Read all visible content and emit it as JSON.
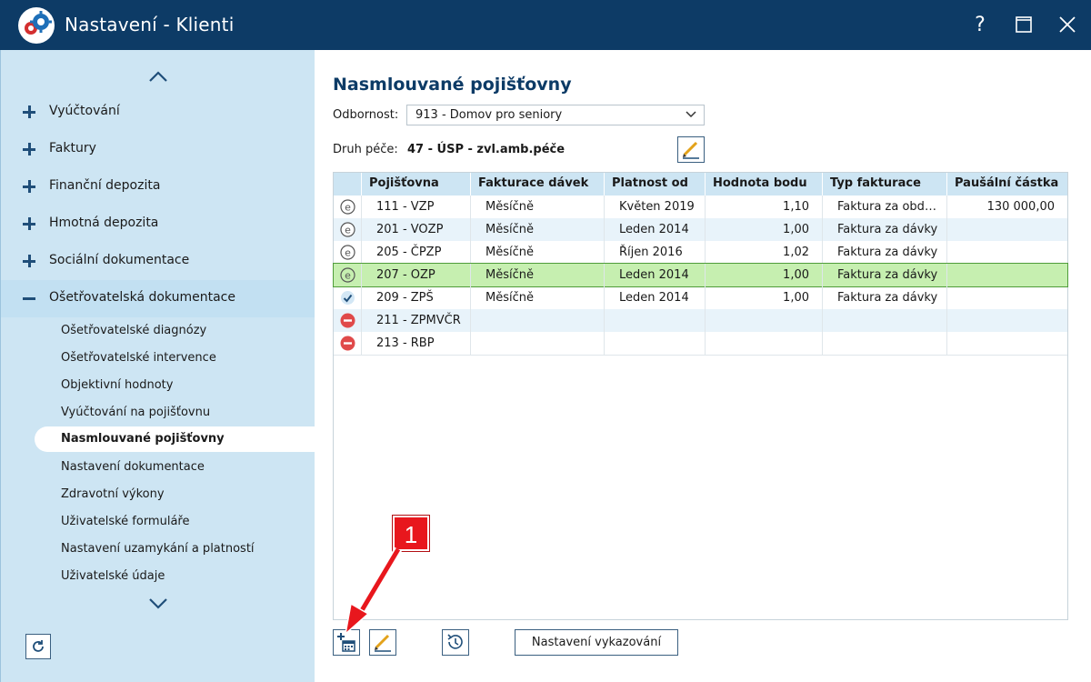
{
  "window": {
    "title": "Nastavení - Klienti",
    "help_label": "?",
    "icons": [
      "app-gears-icon",
      "maximize-icon",
      "close-icon"
    ]
  },
  "sidebar": {
    "groups": [
      {
        "label": "Vyúčtování",
        "icon": "plus-icon"
      },
      {
        "label": "Faktury",
        "icon": "plus-icon"
      },
      {
        "label": "Finanční depozita",
        "icon": "plus-icon"
      },
      {
        "label": "Hmotná depozita",
        "icon": "plus-icon"
      },
      {
        "label": "Sociální dokumentace",
        "icon": "plus-icon"
      },
      {
        "label": "Ošetřovatelská dokumentace",
        "icon": "minus-icon"
      }
    ],
    "subitems": [
      "Ošetřovatelské diagnózy",
      "Ošetřovatelské intervence",
      "Objektivní hodnoty",
      "Vyúčtování na pojišťovnu",
      "Nasmlouvané pojišťovny",
      "Nastavení dokumentace",
      "Zdravotní výkony",
      "Uživatelské formuláře",
      "Nastavení uzamykání a platností",
      "Uživatelské údaje"
    ],
    "active_subitem": "Nasmlouvané pojišťovny"
  },
  "main": {
    "title": "Nasmlouvané pojišťovny",
    "odbornost_label": "Odbornost:",
    "odbornost_value": "913 - Domov pro seniory",
    "druh_label": "Druh péče:",
    "druh_value": "47 - ÚSP - zvl.amb.péče"
  },
  "table": {
    "columns": [
      "Pojišťovna",
      "Fakturace dávek",
      "Platnost od",
      "Hodnota bodu",
      "Typ fakturace",
      "Paušální částka"
    ],
    "rows": [
      {
        "status": "e-icon",
        "pojistovna": "111 - VZP",
        "fakturace": "Měsíčně",
        "platnost": "Květen 2019",
        "hodnota": "1,10",
        "typ": "Faktura za obd…",
        "pausal": "130 000,00"
      },
      {
        "status": "e-icon",
        "pojistovna": "201 - VOZP",
        "fakturace": "Měsíčně",
        "platnost": "Leden 2014",
        "hodnota": "1,00",
        "typ": "Faktura za dávky",
        "pausal": ""
      },
      {
        "status": "e-icon",
        "pojistovna": "205 - ČPZP",
        "fakturace": "Měsíčně",
        "platnost": "Říjen 2016",
        "hodnota": "1,02",
        "typ": "Faktura za dávky",
        "pausal": ""
      },
      {
        "status": "e-icon",
        "pojistovna": "207 - OZP",
        "fakturace": "Měsíčně",
        "platnost": "Leden 2014",
        "hodnota": "1,00",
        "typ": "Faktura za dávky",
        "pausal": ""
      },
      {
        "status": "check-icon",
        "pojistovna": "209 - ZPŠ",
        "fakturace": "Měsíčně",
        "platnost": "Leden 2014",
        "hodnota": "1,00",
        "typ": "Faktura za dávky",
        "pausal": ""
      },
      {
        "status": "minus-circle-icon",
        "pojistovna": "211 - ZPMVČR",
        "fakturace": "",
        "platnost": "",
        "hodnota": "",
        "typ": "",
        "pausal": ""
      },
      {
        "status": "minus-circle-icon",
        "pojistovna": "213 - RBP",
        "fakturace": "",
        "platnost": "",
        "hodnota": "",
        "typ": "",
        "pausal": ""
      }
    ],
    "selected_row": "207 - OZP"
  },
  "toolbar": {
    "vykazovani_label": "Nastavení vykazování",
    "icons": [
      "add-calendar-icon",
      "pencil-icon",
      "history-icon"
    ]
  },
  "annotation": {
    "callout_number": "1"
  },
  "colors": {
    "titlebar": "#0d3b66",
    "sidebar": "#cde5f3",
    "selected_row": "#c6efb0",
    "callout": "#e8171d"
  }
}
